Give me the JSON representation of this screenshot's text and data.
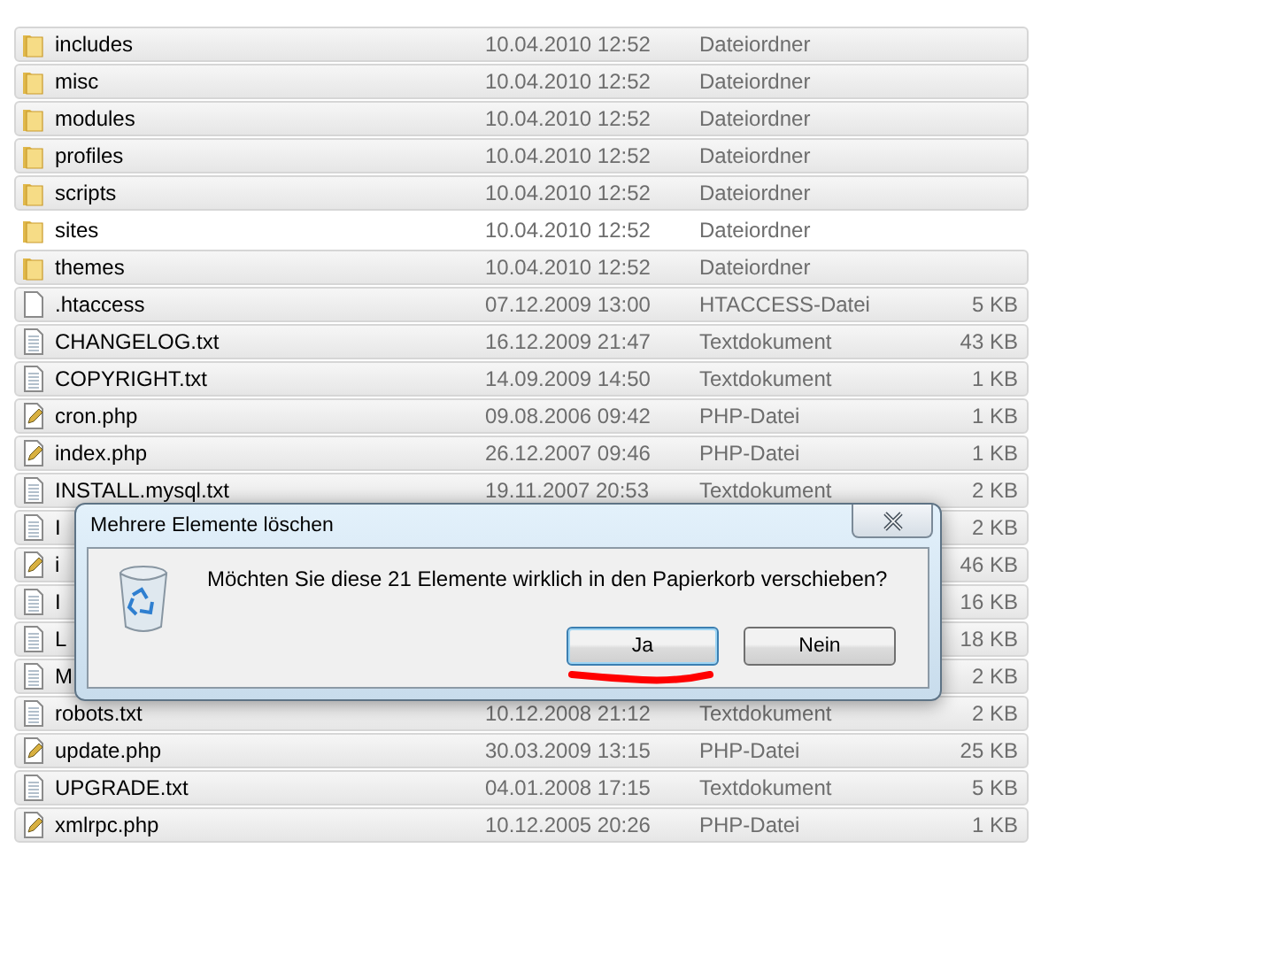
{
  "files": [
    {
      "kind": "folder",
      "name": "includes",
      "modified": "10.04.2010 12:52",
      "type": "Dateiordner",
      "selected": true
    },
    {
      "kind": "folder",
      "name": "misc",
      "modified": "10.04.2010 12:52",
      "type": "Dateiordner",
      "selected": true
    },
    {
      "kind": "folder",
      "name": "modules",
      "modified": "10.04.2010 12:52",
      "type": "Dateiordner",
      "selected": true
    },
    {
      "kind": "folder",
      "name": "profiles",
      "modified": "10.04.2010 12:52",
      "type": "Dateiordner",
      "selected": true
    },
    {
      "kind": "folder",
      "name": "scripts",
      "modified": "10.04.2010 12:52",
      "type": "Dateiordner",
      "selected": true
    },
    {
      "kind": "folder",
      "name": "sites",
      "modified": "10.04.2010 12:52",
      "type": "Dateiordner",
      "selected": false
    },
    {
      "kind": "folder",
      "name": "themes",
      "modified": "10.04.2010 12:52",
      "type": "Dateiordner",
      "selected": true
    },
    {
      "kind": "file",
      "name": ".htaccess",
      "modified": "07.12.2009 13:00",
      "type": "HTACCESS-Datei",
      "size": "5 KB",
      "selected": true
    },
    {
      "kind": "text",
      "name": "CHANGELOG.txt",
      "modified": "16.12.2009 21:47",
      "type": "Textdokument",
      "size": "43 KB",
      "selected": true
    },
    {
      "kind": "text",
      "name": "COPYRIGHT.txt",
      "modified": "14.09.2009 14:50",
      "type": "Textdokument",
      "size": "1 KB",
      "selected": true
    },
    {
      "kind": "php",
      "name": "cron.php",
      "modified": "09.08.2006 09:42",
      "type": "PHP-Datei",
      "size": "1 KB",
      "selected": true
    },
    {
      "kind": "php",
      "name": "index.php",
      "modified": "26.12.2007 09:46",
      "type": "PHP-Datei",
      "size": "1 KB",
      "selected": true
    },
    {
      "kind": "text",
      "name": "INSTALL.mysql.txt",
      "modified": "19.11.2007 20:53",
      "type": "Textdokument",
      "size": "2 KB",
      "selected": true
    },
    {
      "kind": "text",
      "name": "I",
      "size": "2 KB",
      "selected": true
    },
    {
      "kind": "php",
      "name": "i",
      "size": "46 KB",
      "selected": true
    },
    {
      "kind": "text",
      "name": "I",
      "size": "16 KB",
      "selected": true
    },
    {
      "kind": "text",
      "name": "L",
      "size": "18 KB",
      "selected": true
    },
    {
      "kind": "text",
      "name": "M",
      "size": "2 KB",
      "selected": true
    },
    {
      "kind": "text",
      "name": "robots.txt",
      "modified": "10.12.2008 21:12",
      "type": "Textdokument",
      "size": "2 KB",
      "selected": true
    },
    {
      "kind": "php",
      "name": "update.php",
      "modified": "30.03.2009 13:15",
      "type": "PHP-Datei",
      "size": "25 KB",
      "selected": true
    },
    {
      "kind": "text",
      "name": "UPGRADE.txt",
      "modified": "04.01.2008 17:15",
      "type": "Textdokument",
      "size": "5 KB",
      "selected": true
    },
    {
      "kind": "php",
      "name": "xmlrpc.php",
      "modified": "10.12.2005 20:26",
      "type": "PHP-Datei",
      "size": "1 KB",
      "selected": true
    }
  ],
  "dialog": {
    "title": "Mehrere Elemente löschen",
    "message": "Möchten Sie diese 21 Elemente wirklich in den Papierkorb verschieben?",
    "buttons": [
      {
        "label": "Ja",
        "default": true
      },
      {
        "label": "Nein",
        "default": false
      }
    ]
  }
}
